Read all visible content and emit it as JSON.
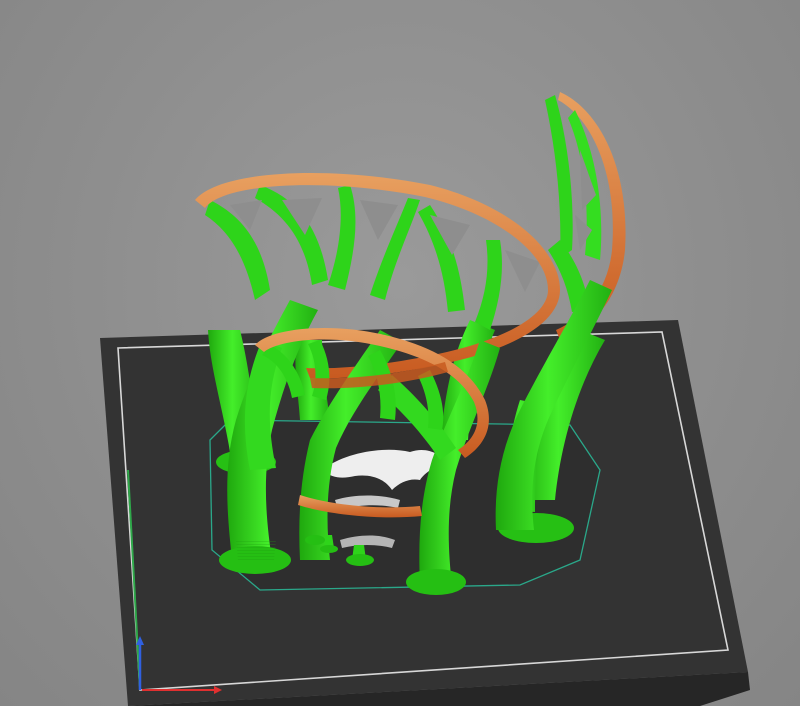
{
  "view": {
    "type": "3d-viewport",
    "background_color": "#8e8e8e",
    "bed_color": "#343434",
    "bed_border_color": "#d8d8d8",
    "model_color": "#32e01c",
    "model_shade_color": "#1fa80e",
    "perimeter_color": "#d86a2c",
    "perimeter_highlight_color": "#e8a060",
    "brim_outline_color": "#2aa88a",
    "bed_logo_color": "#ffffff"
  },
  "axes": {
    "x_color": "#e03030",
    "y_color": "#2fa84a",
    "z_color": "#3060e0"
  },
  "icons": {
    "bed_logo": "dragon-logo",
    "axis_gizmo": "axis-triad-icon"
  }
}
